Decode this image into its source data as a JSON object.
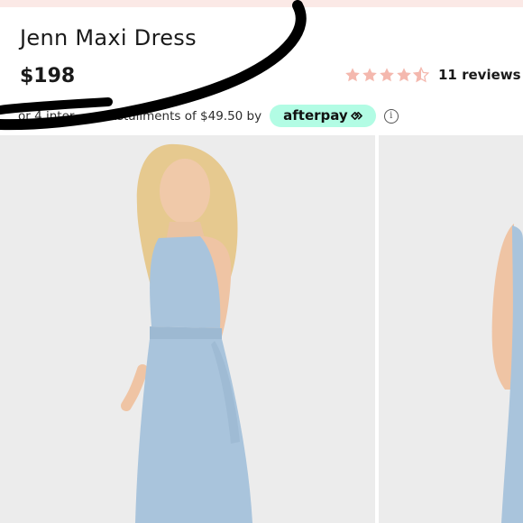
{
  "product": {
    "title": "Jenn Maxi Dress",
    "price": "$198",
    "rating": {
      "stars_filled": 4.5,
      "stars_max": 5,
      "reviews_label": "11 reviews"
    },
    "installments": {
      "text_before": "or 4 inter",
      "text_mid": "nstallments of $49.50 by",
      "brand": "afterpay"
    }
  },
  "colors": {
    "star": "#f4b8ae",
    "afterpay_badge": "#b2fce4",
    "dress": "#a9c4dc",
    "photo_bg": "#ededed",
    "annotation_ink": "#000000"
  },
  "icons": {
    "rating": "star-icon",
    "afterpay": "afterpay-loop-icon",
    "info": "info-icon"
  }
}
